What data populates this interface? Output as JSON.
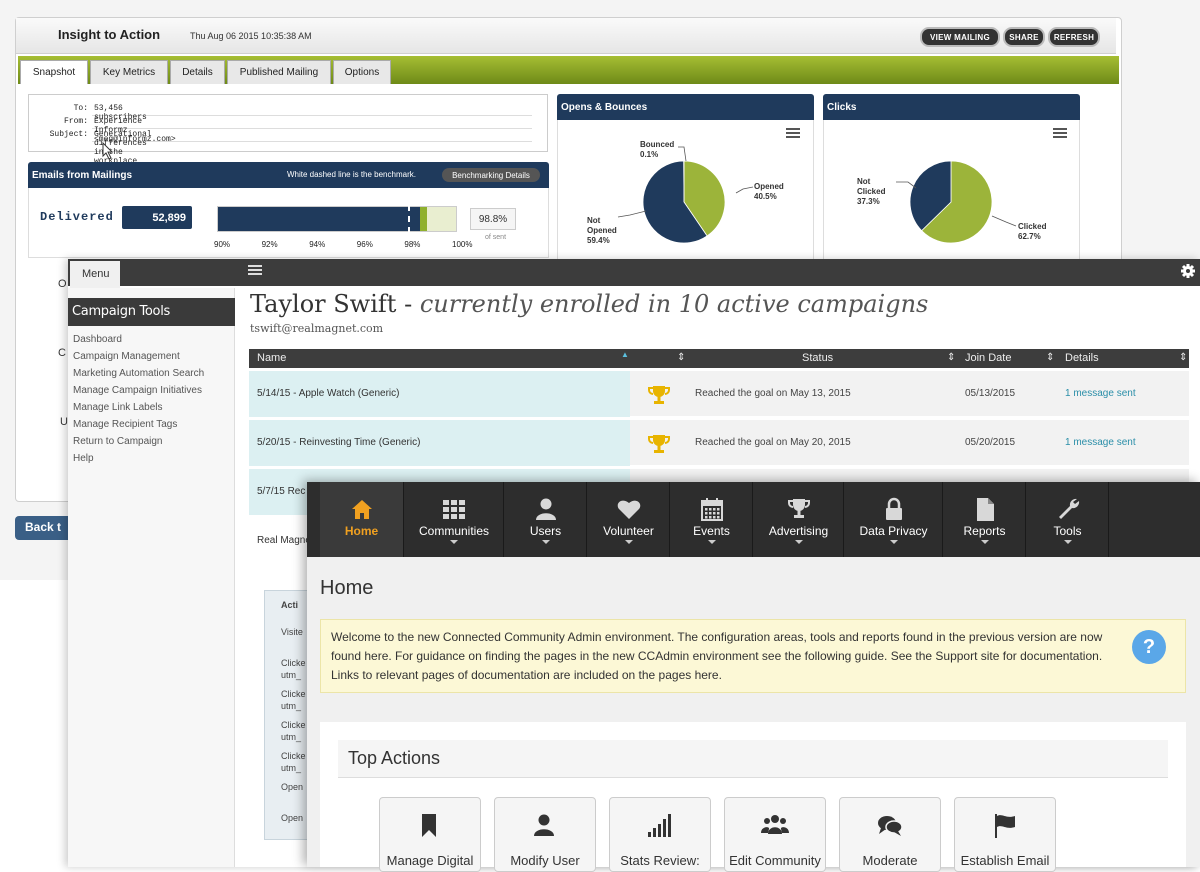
{
  "insight": {
    "title": "Insight to Action",
    "datetime": "Thu Aug 06 2015 10:35:38 AM",
    "buttons": [
      "VIEW MAILING",
      "SHARE",
      "REFRESH"
    ],
    "tabs": [
      "Snapshot",
      "Key Metrics",
      "Details",
      "Published Mailing",
      "Options"
    ],
    "mail": {
      "to_label": "To:",
      "to": "53,456 subscribers",
      "from_label": "From:",
      "from": "Experience Informz <meg@informz.com>",
      "subject_label": "Subject:",
      "subject": "Generational differences in the workplace"
    },
    "emails_panel": {
      "title": "Emails from Mailings",
      "note": "White dashed line is the benchmark.",
      "bench_button": "Benchmarking Details",
      "delivered_label": "Delivered",
      "delivered_value": "52,899",
      "delivered_pct": "98.8%",
      "of_sent": "of sent",
      "axis": [
        "90%",
        "92%",
        "94%",
        "96%",
        "98%",
        "100%"
      ],
      "delivered_fraction": 0.988,
      "benchmark_fraction": 0.98
    },
    "opens": {
      "title": "Opens & Bounces",
      "slices": [
        {
          "label": "Opened",
          "pct": "40.5%",
          "value": 40.5,
          "color": "#9cb43a"
        },
        {
          "label": "Not Opened",
          "pct": "59.4%",
          "value": 59.4,
          "color": "#1f3a5c"
        },
        {
          "label": "Bounced",
          "pct": "0.1%",
          "value": 0.1,
          "color": "#cccccc"
        }
      ]
    },
    "clicks": {
      "title": "Clicks",
      "slices": [
        {
          "label": "Clicked",
          "pct": "62.7%",
          "value": 62.7,
          "color": "#9cb43a"
        },
        {
          "label": "Not Clicked",
          "pct": "37.3%",
          "value": 37.3,
          "color": "#1f3a5c"
        }
      ]
    },
    "back_label": "Back t"
  },
  "campaign": {
    "menu_tab": "Menu",
    "sidebar_title": "Campaign Tools",
    "links": [
      "Dashboard",
      "Campaign Management",
      "Marketing Automation Search",
      "Manage Campaign Initiatives",
      "Manage Link Labels",
      "Manage Recipient Tags",
      "Return to Campaign",
      "Help"
    ],
    "person": "Taylor Swift",
    "enrolled": "currently enrolled in 10 active campaigns",
    "email": "tswift@realmagnet.com",
    "columns": [
      "Name",
      "Status",
      "Join Date",
      "Details"
    ],
    "rows": [
      {
        "name": "5/14/15 - Apple Watch (Generic)",
        "status": "Reached the goal on May 13, 2015",
        "join": "05/13/2015",
        "details": "1 message sent"
      },
      {
        "name": "5/20/15 - Reinvesting Time (Generic)",
        "status": "Reached the goal on May 20, 2015",
        "join": "05/20/2015",
        "details": "1 message sent"
      },
      {
        "name": "5/7/15 Rec",
        "status": "",
        "join": "",
        "details": ""
      },
      {
        "name": "Real Magne",
        "status": "",
        "join": "",
        "details": ""
      }
    ],
    "actions_head": "Acti",
    "action_rows": [
      "Visite",
      "Clicke utm_",
      "Clicke utm_",
      "Clicke utm_",
      "Clicke utm_",
      "Open",
      "Open"
    ],
    "partial_labels": [
      "O",
      "C",
      "U"
    ]
  },
  "ccadmin": {
    "nav": [
      {
        "label": "Home",
        "icon": "home-icon",
        "caret": false,
        "active": true
      },
      {
        "label": "Communities",
        "icon": "grid-icon",
        "caret": true,
        "active": false
      },
      {
        "label": "Users",
        "icon": "user-icon",
        "caret": true,
        "active": false
      },
      {
        "label": "Volunteer",
        "icon": "heart-icon",
        "caret": true,
        "active": false
      },
      {
        "label": "Events",
        "icon": "calendar-icon",
        "caret": true,
        "active": false
      },
      {
        "label": "Advertising",
        "icon": "trophy-icon",
        "caret": true,
        "active": false
      },
      {
        "label": "Data Privacy",
        "icon": "lock-icon",
        "caret": true,
        "active": false
      },
      {
        "label": "Reports",
        "icon": "file-icon",
        "caret": true,
        "active": false
      },
      {
        "label": "Tools",
        "icon": "wrench-icon",
        "caret": true,
        "active": false
      }
    ],
    "page_title": "Home",
    "welcome": "Welcome to the new Connected Community Admin environment. The configuration areas, tools and reports found in the previous version are now found here. For guidance on finding the pages in the new CCAdmin environment see the following guide. See the Support site for documentation. Links to relevant pages of documentation are included on the pages here.",
    "help_glyph": "?",
    "top_actions_title": "Top Actions",
    "actions": [
      {
        "label": "Manage Digital",
        "icon": "bookmark-icon"
      },
      {
        "label": "Modify User",
        "icon": "user-icon"
      },
      {
        "label": "Stats Review:",
        "icon": "signal-bars-icon"
      },
      {
        "label": "Edit Community",
        "icon": "group-icon"
      },
      {
        "label": "Moderate",
        "icon": "comments-icon"
      },
      {
        "label": "Establish Email",
        "icon": "flag-icon"
      }
    ]
  }
}
